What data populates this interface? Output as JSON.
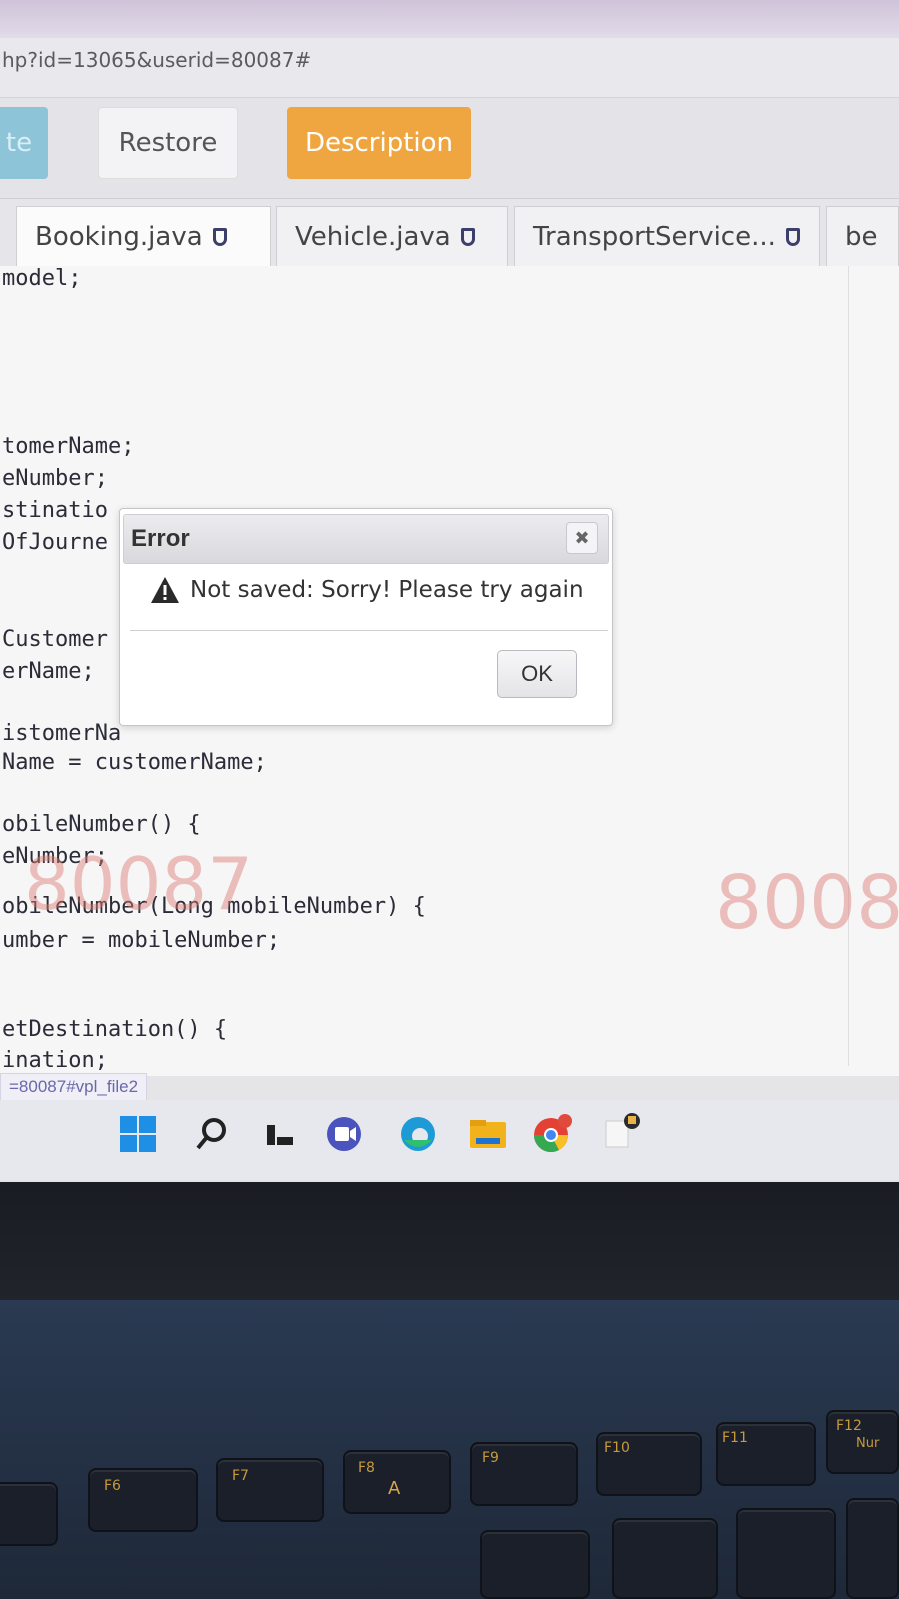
{
  "browser": {
    "url": "hp?id=13065&userid=80087#",
    "status_url": "=80087#vpl_file2"
  },
  "toolbar": {
    "partial_button": "te",
    "restore_label": "Restore",
    "description_label": "Description"
  },
  "tabs": [
    {
      "label": "Booking.java"
    },
    {
      "label": "Vehicle.java"
    },
    {
      "label": "TransportService..."
    },
    {
      "label": "be"
    }
  ],
  "code_lines": [
    "model;",
    "tomerName;",
    "eNumber;",
    "stinatio",
    "OfJourne",
    "Customer",
    "erName;",
    "istomerNa",
    "Name = customerName;",
    "obileNumber() {",
    "eNumber;",
    "obileNumber(Long mobileNumber) {",
    "umber = mobileNumber;",
    "etDestination() {",
    "ination;"
  ],
  "watermark": {
    "left": "80087",
    "right": "8008"
  },
  "dialog": {
    "title": "Error",
    "close_glyph": "✖",
    "message": "Not saved: Sorry! Please try again",
    "ok_label": "OK"
  },
  "keyboard": {
    "f6": "F6",
    "f7": "F7",
    "f8": "F8",
    "f8_glyph": "A",
    "f9": "F9",
    "f10": "F10",
    "f11": "F11",
    "f12": "F12",
    "num": "Nur"
  }
}
